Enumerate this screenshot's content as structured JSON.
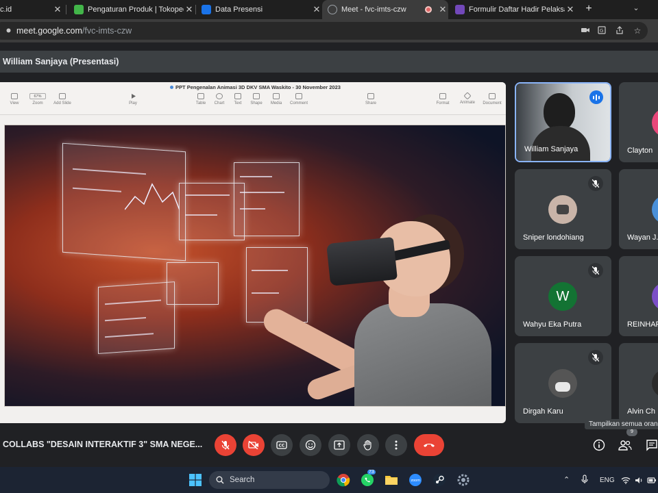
{
  "browser": {
    "tabs": [
      {
        "title": "c.id",
        "favicon_color": "#333333",
        "active": false
      },
      {
        "title": "Pengaturan Produk | Tokopedia",
        "favicon_color": "#42b549",
        "active": false
      },
      {
        "title": "Data Presensi",
        "favicon_color": "#1a73e8",
        "active": false
      },
      {
        "title": "Meet - fvc-imts-czw",
        "favicon_color": "#9aa0a6",
        "active": true
      },
      {
        "title": "Formulir Daftar Hadir Pelaksana",
        "favicon_color": "#7248b9",
        "active": false
      }
    ],
    "new_tab_symbol": "+",
    "url_host": "meet.google.com",
    "url_path": "/fvc-imts-czw"
  },
  "presentation": {
    "header_title": "William Sanjaya (Presentasi)",
    "document_title": "PPT Pengenalan Animasi 3D DKV SMA Waskito - 30 November 2023",
    "zoom": "67%",
    "toolbar": [
      "View",
      "Zoom",
      "Add Slide",
      "Play",
      "Table",
      "Chart",
      "Text",
      "Shape",
      "Media",
      "Comment",
      "Share",
      "Format",
      "Animate",
      "Document"
    ]
  },
  "participants": [
    {
      "name": "William Sanjaya",
      "speaking": true,
      "video": true
    },
    {
      "name": "Clayton",
      "partial": true
    },
    {
      "name": "Sniper londohiang",
      "muted": true,
      "avatar_color": "#b8a79a"
    },
    {
      "name": "Wayan J...",
      "partial": true,
      "avatar_color": "#4a90d9"
    },
    {
      "name": "Wahyu Eka Putra",
      "muted": true,
      "avatar_letter": "W",
      "avatar_color": "#137333"
    },
    {
      "name": "REINHAR",
      "partial": true,
      "avatar_color": "#7b4fc7"
    },
    {
      "name": "Dirgah Karu",
      "muted": true,
      "avatar_color": "#555555"
    },
    {
      "name": "Alvin Ch",
      "partial": true
    }
  ],
  "controls": {
    "meeting_title": "COLLABS \"DESAIN INTERAKTIF 3\" SMA NEGE...",
    "tooltip": "Tampilkan semua oran",
    "people_count": "9"
  },
  "taskbar": {
    "search_label": "Search",
    "whatsapp_badge": "73",
    "language": "ENG"
  }
}
